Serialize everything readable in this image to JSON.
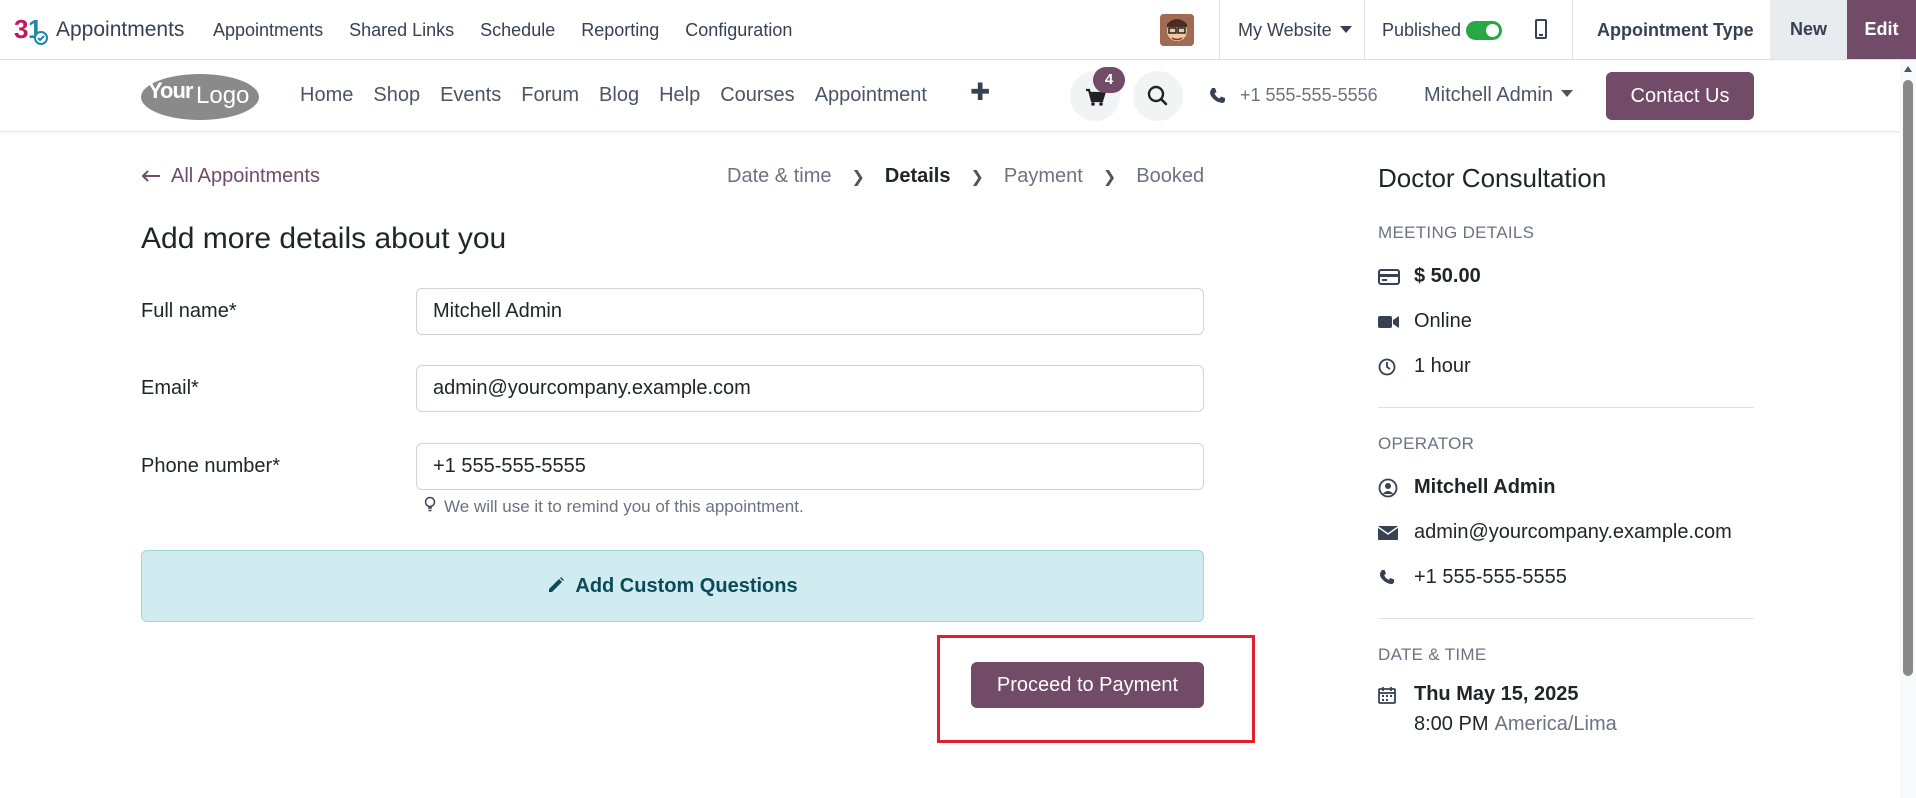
{
  "odoo_bar": {
    "app_name": "Appointments",
    "menu": [
      "Appointments",
      "Shared Links",
      "Schedule",
      "Reporting",
      "Configuration"
    ],
    "website_selector": "My Website",
    "published_label": "Published",
    "published": true,
    "record_label": "Appointment Type",
    "new_label": "New",
    "edit_label": "Edit"
  },
  "site_header": {
    "logo_text": "YourLogo",
    "menu": [
      "Home",
      "Shop",
      "Events",
      "Forum",
      "Blog",
      "Help",
      "Courses",
      "Appointment"
    ],
    "cart_count": "4",
    "phone": "+1 555-555-5556",
    "user_name": "Mitchell Admin",
    "contact_label": "Contact Us"
  },
  "form": {
    "back_label": "All Appointments",
    "steps": [
      "Date & time",
      "Details",
      "Payment",
      "Booked"
    ],
    "active_step": "Details",
    "heading": "Add more details about you",
    "fields": {
      "full_name": {
        "label": "Full name*",
        "value": "Mitchell Admin"
      },
      "email": {
        "label": "Email*",
        "value": "admin@yourcompany.example.com"
      },
      "phone": {
        "label": "Phone number*",
        "value": "+1 555-555-5555"
      }
    },
    "phone_hint": "We will use it to remind you of this appointment.",
    "custom_questions_label": "Add Custom Questions",
    "proceed_label": "Proceed to Payment"
  },
  "summary": {
    "title": "Doctor Consultation",
    "meeting_details_label": "MEETING DETAILS",
    "price": "$ 50.00",
    "location": "Online",
    "duration": "1 hour",
    "operator_label": "OPERATOR",
    "operator_name": "Mitchell Admin",
    "operator_email": "admin@yourcompany.example.com",
    "operator_phone": "+1 555-555-5555",
    "datetime_label": "DATE & TIME",
    "date": "Thu May 15, 2025",
    "time": "8:00 PM",
    "timezone": "America/Lima"
  },
  "colors": {
    "brand": "#714b67",
    "info_bg": "#d1ecf1",
    "highlight": "#e0202a",
    "toggle_on": "#28a745"
  }
}
